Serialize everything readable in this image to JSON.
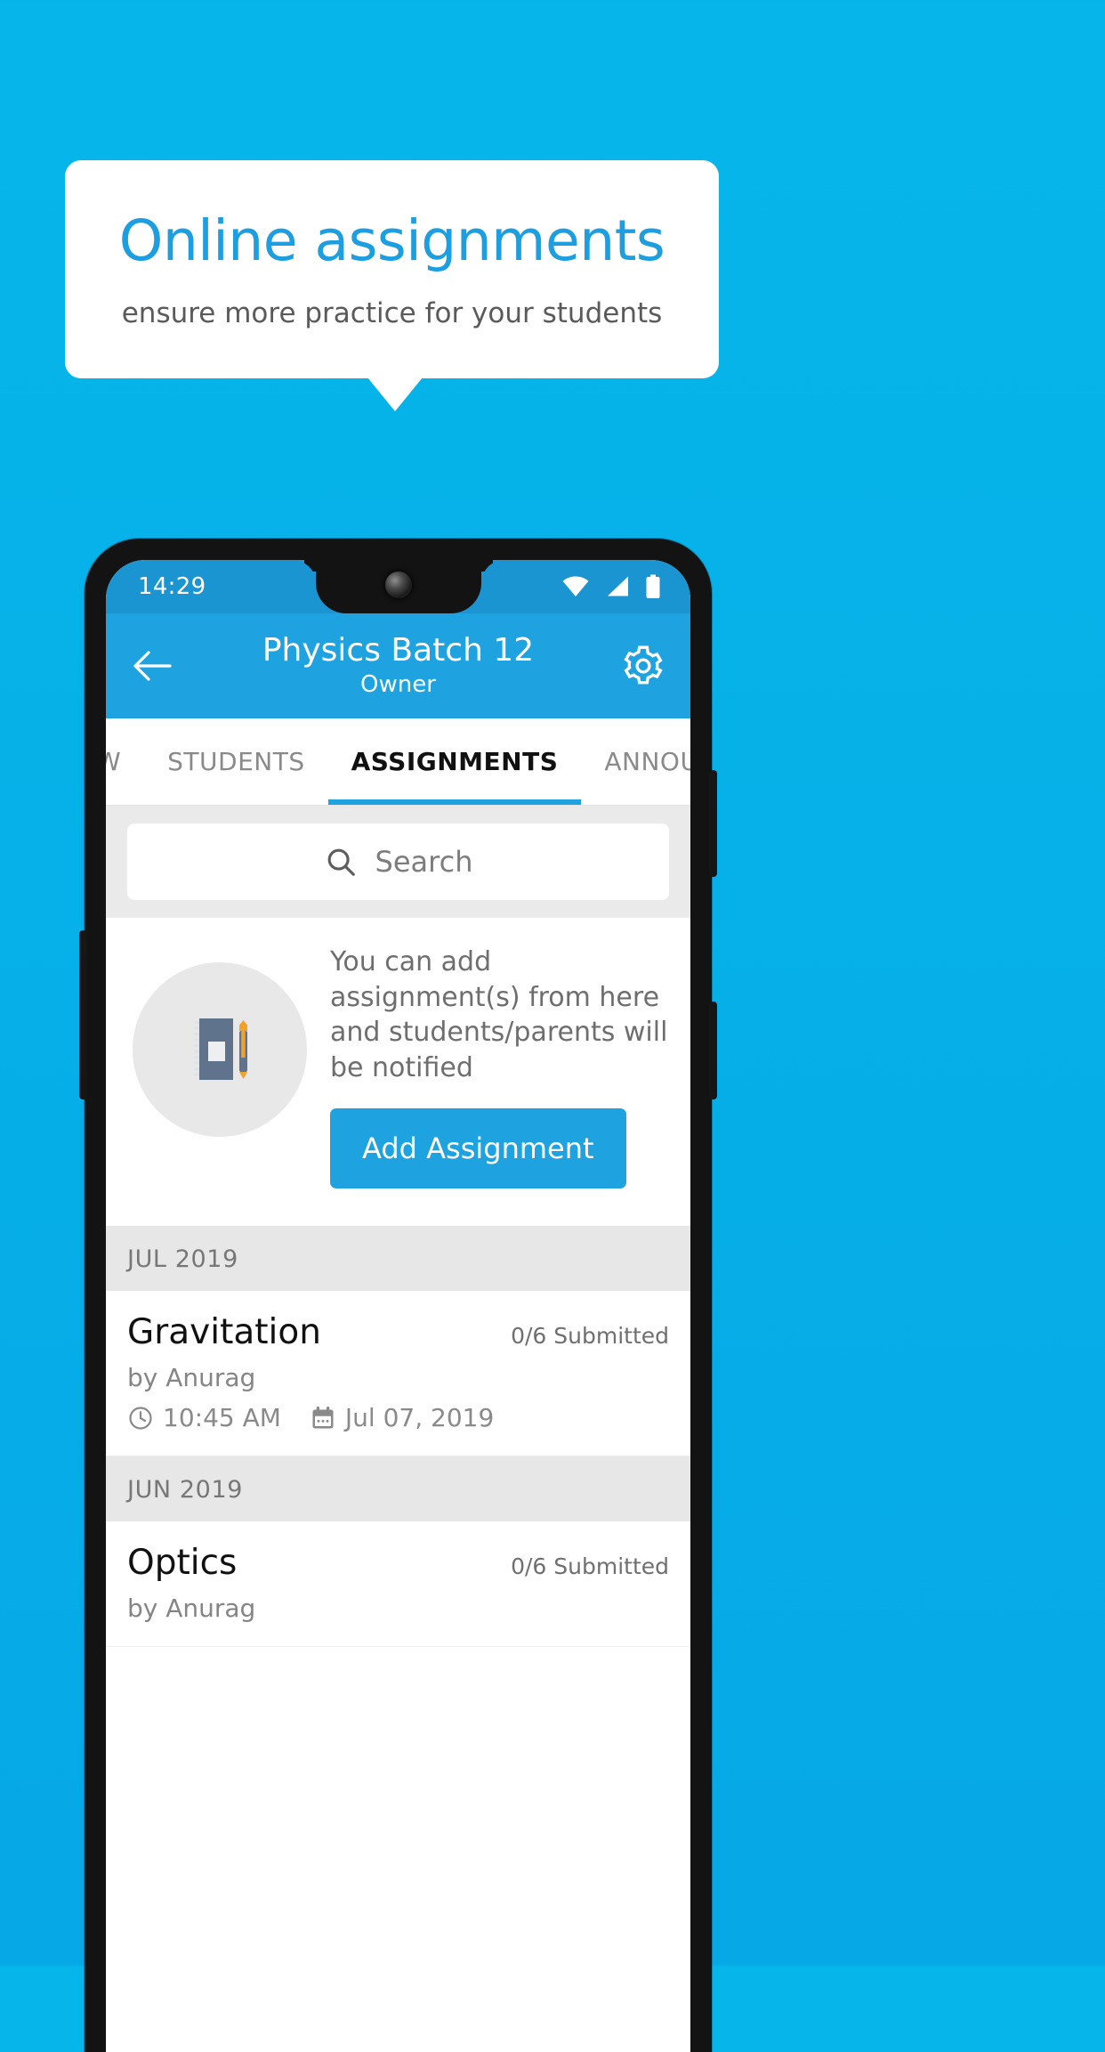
{
  "promo": {
    "title": "Online assignments",
    "subtitle": "ensure more practice for your students"
  },
  "colors": {
    "background": "#06b0e8",
    "accent": "#1fa3e0",
    "statusbar": "#1b94d2",
    "promo_title": "#1c9ee0",
    "muted_text": "#858585",
    "section_header_bg": "#e7e7e7"
  },
  "phone": {
    "statusbar": {
      "time": "14:29",
      "icons": [
        "wifi-icon",
        "signal-icon",
        "battery-icon"
      ]
    },
    "appbar": {
      "back_icon": "arrow-left-icon",
      "title": "Physics Batch 12",
      "subtitle": "Owner",
      "settings_icon": "gear-icon"
    },
    "tabs": [
      {
        "label": "IEW",
        "active": false
      },
      {
        "label": "STUDENTS",
        "active": false
      },
      {
        "label": "ASSIGNMENTS",
        "active": true
      },
      {
        "label": "ANNOUNCEMENTS",
        "active": false
      }
    ],
    "search": {
      "icon": "search-icon",
      "placeholder": "Search",
      "value": ""
    },
    "empty_state": {
      "illustration": "notebook-pen-icon",
      "message": "You can add assignment(s) from here and students/parents will be notified",
      "button_label": "Add Assignment"
    },
    "list": [
      {
        "month": "JUL 2019",
        "items": [
          {
            "title": "Gravitation",
            "submitted": "0/6 Submitted",
            "author": "by Anurag",
            "time_icon": "clock-icon",
            "time": "10:45 AM",
            "date_icon": "calendar-icon",
            "date": "Jul 07, 2019"
          }
        ]
      },
      {
        "month": "JUN 2019",
        "items": [
          {
            "title": "Optics",
            "submitted": "0/6 Submitted",
            "author": "by Anurag",
            "time_icon": "clock-icon",
            "time": "",
            "date_icon": "calendar-icon",
            "date": ""
          }
        ]
      }
    ]
  }
}
